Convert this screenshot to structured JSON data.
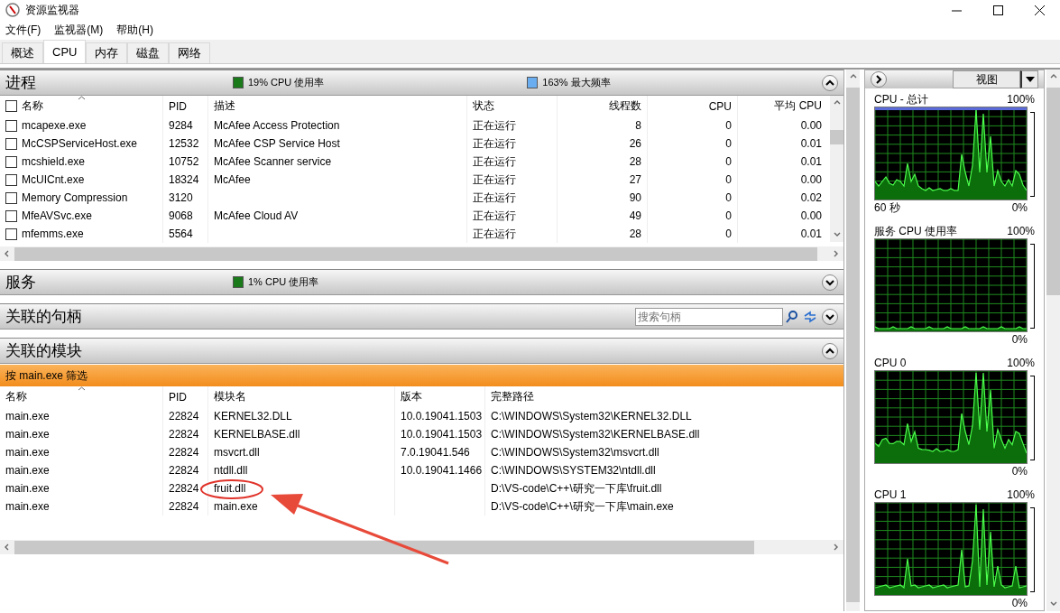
{
  "window": {
    "title": "资源监视器"
  },
  "menu": [
    "文件(F)",
    "监视器(M)",
    "帮助(H)"
  ],
  "tabs": [
    {
      "label": "概述",
      "selected": false
    },
    {
      "label": "CPU",
      "selected": true
    },
    {
      "label": "内存",
      "selected": false
    },
    {
      "label": "磁盘",
      "selected": false
    },
    {
      "label": "网络",
      "selected": false
    }
  ],
  "processes": {
    "title": "进程",
    "expanded": true,
    "stats": [
      {
        "kind": "usage",
        "text": "19% CPU 使用率"
      },
      {
        "kind": "frequency",
        "text": "163% 最大频率"
      }
    ],
    "all_checked": false,
    "columns": [
      "名称",
      "PID",
      "描述",
      "状态",
      "线程数",
      "CPU",
      "平均 CPU"
    ],
    "rows": [
      {
        "checked": false,
        "cells": [
          "mcapexe.exe",
          "9284",
          "McAfee Access Protection",
          "正在运行",
          "8",
          "0",
          "0.00"
        ]
      },
      {
        "checked": false,
        "cells": [
          "McCSPServiceHost.exe",
          "12532",
          "McAfee CSP Service Host",
          "正在运行",
          "26",
          "0",
          "0.01"
        ]
      },
      {
        "checked": false,
        "cells": [
          "mcshield.exe",
          "10752",
          "McAfee Scanner service",
          "正在运行",
          "28",
          "0",
          "0.01"
        ]
      },
      {
        "checked": false,
        "cells": [
          "McUICnt.exe",
          "18324",
          "McAfee",
          "正在运行",
          "27",
          "0",
          "0.00"
        ]
      },
      {
        "checked": false,
        "cells": [
          "Memory Compression",
          "3120",
          "",
          "正在运行",
          "90",
          "0",
          "0.02"
        ]
      },
      {
        "checked": false,
        "cells": [
          "MfeAVSvc.exe",
          "9068",
          "McAfee Cloud AV",
          "正在运行",
          "49",
          "0",
          "0.00"
        ]
      },
      {
        "checked": false,
        "cells": [
          "mfemms.exe",
          "5564",
          "",
          "正在运行",
          "28",
          "0",
          "0.01"
        ]
      }
    ]
  },
  "services": {
    "title": "服务",
    "expanded": false,
    "stats": [
      {
        "kind": "usage",
        "text": "1% CPU 使用率"
      }
    ]
  },
  "handles": {
    "title": "关联的句柄",
    "expanded": false,
    "search": {
      "placeholder": "搜索句柄"
    }
  },
  "modules": {
    "title": "关联的模块",
    "expanded": true,
    "filter": "按 main.exe 筛选",
    "columns": [
      "名称",
      "PID",
      "模块名",
      "版本",
      "完整路径"
    ],
    "rows": [
      [
        "main.exe",
        "22824",
        "KERNEL32.DLL",
        "10.0.19041.1503",
        "C:\\WINDOWS\\System32\\KERNEL32.DLL"
      ],
      [
        "main.exe",
        "22824",
        "KERNELBASE.dll",
        "10.0.19041.1503",
        "C:\\WINDOWS\\System32\\KERNELBASE.dll"
      ],
      [
        "main.exe",
        "22824",
        "msvcrt.dll",
        "7.0.19041.546",
        "C:\\WINDOWS\\System32\\msvcrt.dll"
      ],
      [
        "main.exe",
        "22824",
        "ntdll.dll",
        "10.0.19041.1466",
        "C:\\WINDOWS\\SYSTEM32\\ntdll.dll"
      ],
      [
        "main.exe",
        "22824",
        "fruit.dll",
        "",
        "D:\\VS-code\\C++\\研究一下库\\fruit.dll"
      ],
      [
        "main.exe",
        "22824",
        "main.exe",
        "",
        "D:\\VS-code\\C++\\研究一下库\\main.exe"
      ]
    ]
  },
  "right_panel": {
    "view_button": "视图",
    "graphs": [
      {
        "title": "CPU - 总计",
        "max": "100%",
        "min": "0%",
        "time": "60 秒",
        "frequency_line": true
      },
      {
        "title": "服务 CPU 使用率",
        "max": "100%",
        "min": "0%",
        "frequency_line": false
      },
      {
        "title": "CPU 0",
        "max": "100%",
        "min": "0%",
        "frequency_line": false
      },
      {
        "title": "CPU 1",
        "max": "100%",
        "min": "0%",
        "frequency_line": false
      }
    ]
  }
}
